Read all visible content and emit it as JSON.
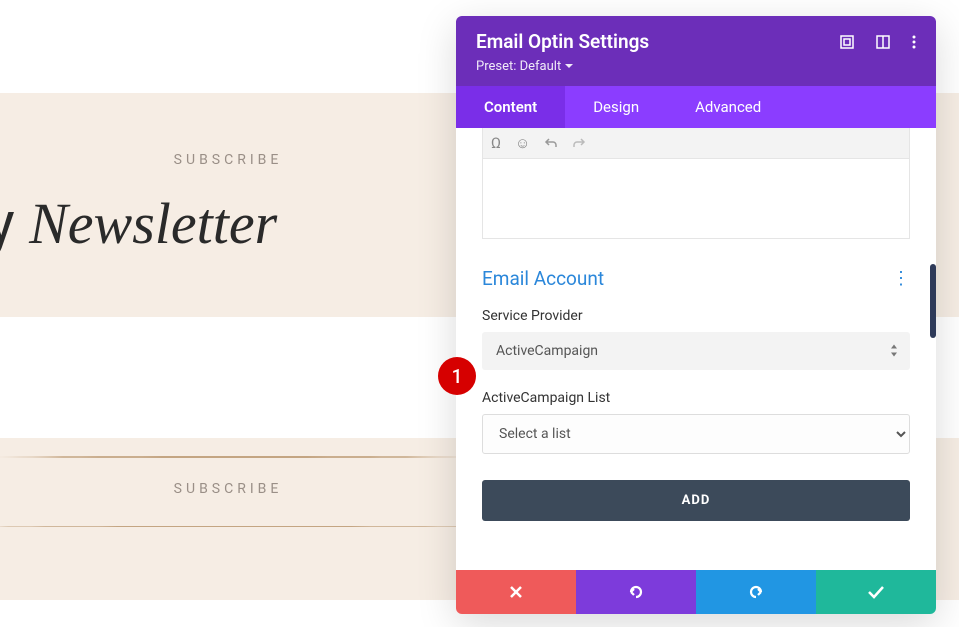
{
  "page": {
    "subscribe_small": "SUBSCRIBE",
    "heading_plain": "n my ",
    "heading_italic": "Newsletter",
    "subscribe_low": "SUBSCRIBE"
  },
  "panel": {
    "title": "Email Optin Settings",
    "preset": "Preset: Default",
    "tabs": {
      "content": "Content",
      "design": "Design",
      "advanced": "Advanced"
    }
  },
  "email": {
    "section_title": "Email Account",
    "provider_label": "Service Provider",
    "provider_value": "ActiveCampaign",
    "list_label": "ActiveCampaign List",
    "list_placeholder": "Select a list",
    "add_button": "ADD"
  },
  "badge": {
    "number": "1"
  }
}
